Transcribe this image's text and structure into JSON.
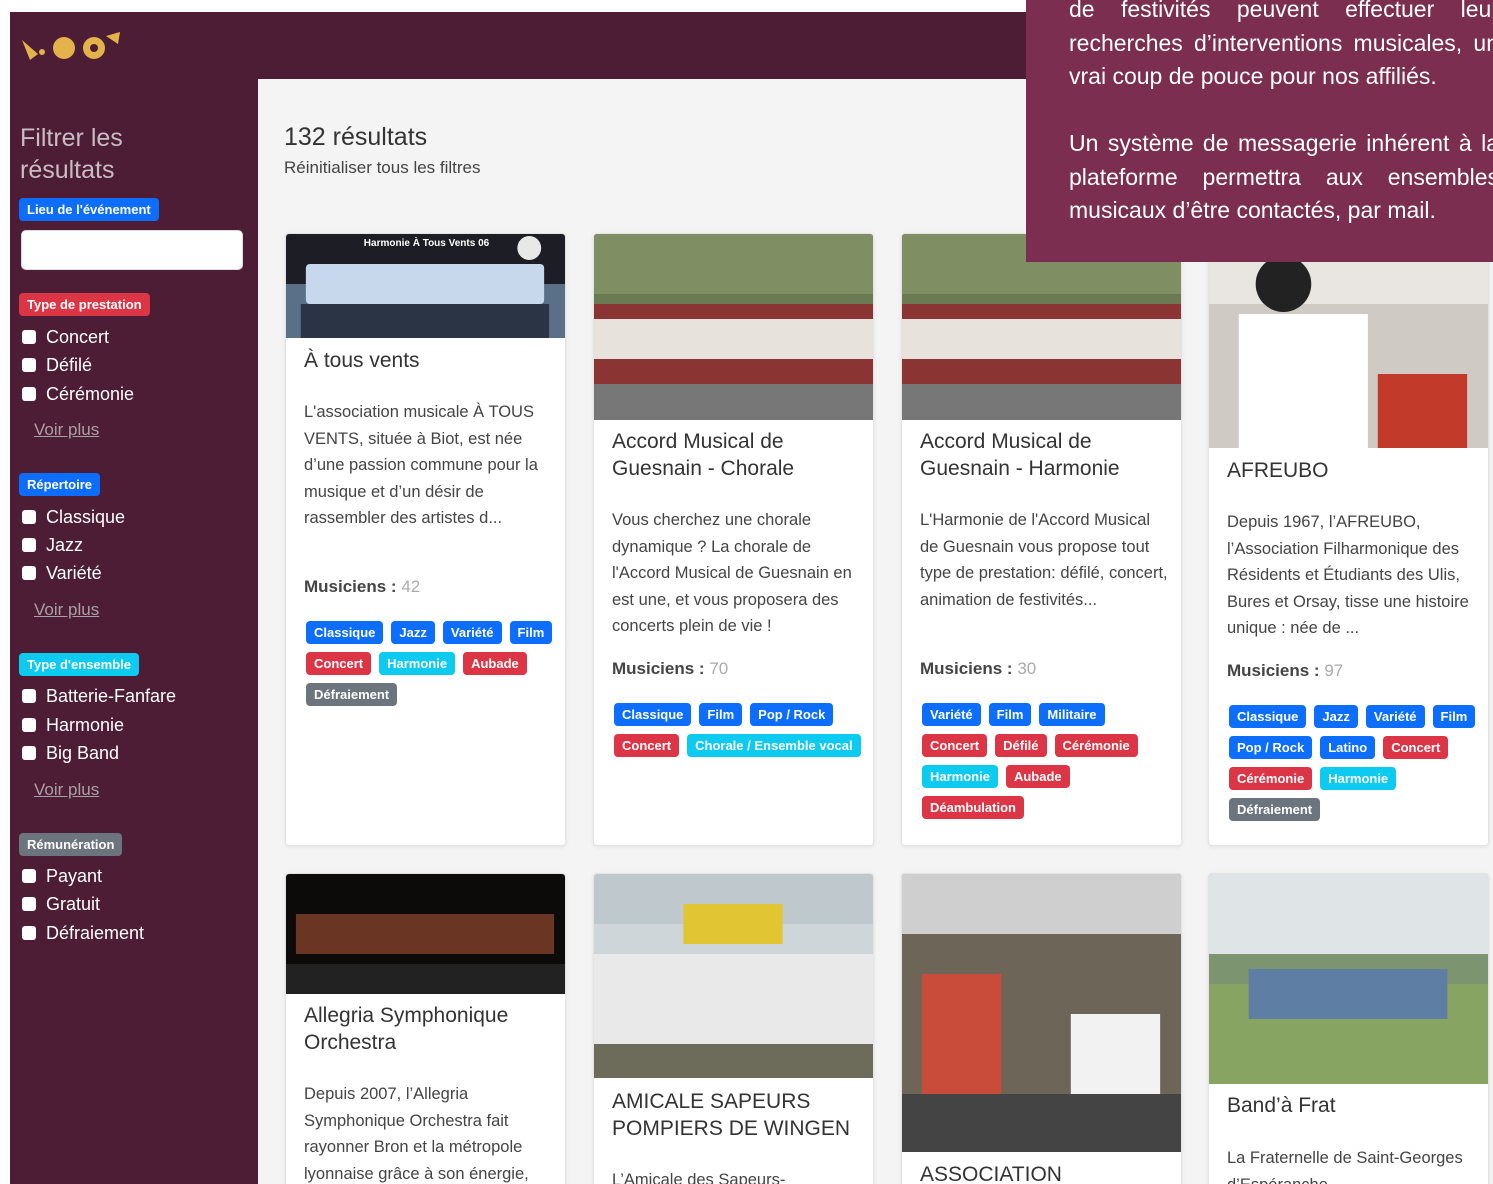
{
  "colors": {
    "sidebar": "#4d1c35",
    "overlay": "#7b2e4f",
    "blue": "#0d6efd",
    "red": "#dc3545",
    "cyan": "#0dcaf0",
    "gray": "#6c757d"
  },
  "sidebar": {
    "title": "Filtrer les résultats",
    "lieu_label": "Lieu de l'événement",
    "lieu_value": "",
    "prestation_label": "Type de prestation",
    "prestation_items": [
      "Concert",
      "Défilé",
      "Cérémonie"
    ],
    "repertoire_label": "Répertoire",
    "repertoire_items": [
      "Classique",
      "Jazz",
      "Variété"
    ],
    "ensemble_label": "Type d'ensemble",
    "ensemble_items": [
      "Batterie-Fanfare",
      "Harmonie",
      "Big Band"
    ],
    "remuneration_label": "Rémunération",
    "remuneration_items": [
      "Payant",
      "Gratuit",
      "Défraiement"
    ],
    "voir_plus": "Voir plus"
  },
  "main": {
    "count": "132 résultats",
    "reset": "Réinitialiser tous les filtres"
  },
  "overlay": {
    "line1": "de festivités peuvent effectuer leur recherches d’interventions musicales, un vrai coup de pouce pour nos affiliés.",
    "line2": "Un système de messagerie inhérent à la plateforme permettra aux ensembles musicaux d’être contactés, par mail."
  },
  "cards": [
    {
      "image_caption": "Harmonie À Tous Vents 06",
      "title": "À tous vents",
      "desc": "L'association musicale À TOUS VENTS, située à Biot, est née d’une passion commune pour la musique et d’un désir de rassembler des artistes d...",
      "mus_label": "Musiciens :",
      "mus": "42",
      "tags": [
        [
          "Classique",
          "blue"
        ],
        [
          "Jazz",
          "blue"
        ],
        [
          "Variété",
          "blue"
        ],
        [
          "Film",
          "blue"
        ],
        [
          "Concert",
          "red"
        ],
        [
          "Harmonie",
          "cyan"
        ],
        [
          "Aubade",
          "red"
        ],
        [
          "Défraiement",
          "gray"
        ]
      ]
    },
    {
      "title": "Accord Musical de Guesnain - Chorale",
      "desc": "Vous cherchez une chorale dynamique ? La chorale de l'Accord Musical de Guesnain en est une, et vous proposera des concerts plein de vie !",
      "mus_label": "Musiciens :",
      "mus": "70",
      "tags": [
        [
          "Classique",
          "blue"
        ],
        [
          "Film",
          "blue"
        ],
        [
          "Pop / Rock",
          "blue"
        ],
        [
          "Concert",
          "red"
        ],
        [
          "Chorale / Ensemble vocal",
          "cyan"
        ]
      ]
    },
    {
      "title": "Accord Musical de Guesnain - Harmonie",
      "desc": "L'Harmonie de l'Accord Musical de Guesnain vous propose tout type de prestation: défilé, concert, animation de festivités...",
      "mus_label": "Musiciens :",
      "mus": "30",
      "tags": [
        [
          "Variété",
          "blue"
        ],
        [
          "Film",
          "blue"
        ],
        [
          "Militaire",
          "blue"
        ],
        [
          "Concert",
          "red"
        ],
        [
          "Défilé",
          "red"
        ],
        [
          "Cérémonie",
          "red"
        ],
        [
          "Harmonie",
          "cyan"
        ],
        [
          "Aubade",
          "red"
        ],
        [
          "Déambulation",
          "red"
        ]
      ]
    },
    {
      "title": "AFREUBO",
      "desc": "Depuis 1967, l’AFREUBO, l’Association Filharmonique des Résidents et Étudiants des Ulis, Bures et Orsay, tisse une histoire unique : née de ...",
      "mus_label": "Musiciens :",
      "mus": "97",
      "tags": [
        [
          "Classique",
          "blue"
        ],
        [
          "Jazz",
          "blue"
        ],
        [
          "Variété",
          "blue"
        ],
        [
          "Film",
          "blue"
        ],
        [
          "Pop / Rock",
          "blue"
        ],
        [
          "Latino",
          "blue"
        ],
        [
          "Concert",
          "red"
        ],
        [
          "Cérémonie",
          "red"
        ],
        [
          "Harmonie",
          "cyan"
        ],
        [
          "Défraiement",
          "gray"
        ]
      ]
    },
    {
      "title": "Allegria Symphonique Orchestra",
      "desc": "Depuis 2007, l’Allegria Symphonique Orchestra fait rayonner Bron et la métropole lyonnaise grâce à son énergie,"
    },
    {
      "title": "AMICALE SAPEURS POMPIERS DE WINGEN",
      "desc": "L’Amicale des Sapeurs-"
    },
    {
      "title": "ASSOCIATION",
      "desc": ""
    },
    {
      "title": "Band’à Frat",
      "desc": "La Fraternelle de Saint-Georges d’Espéranche"
    }
  ]
}
